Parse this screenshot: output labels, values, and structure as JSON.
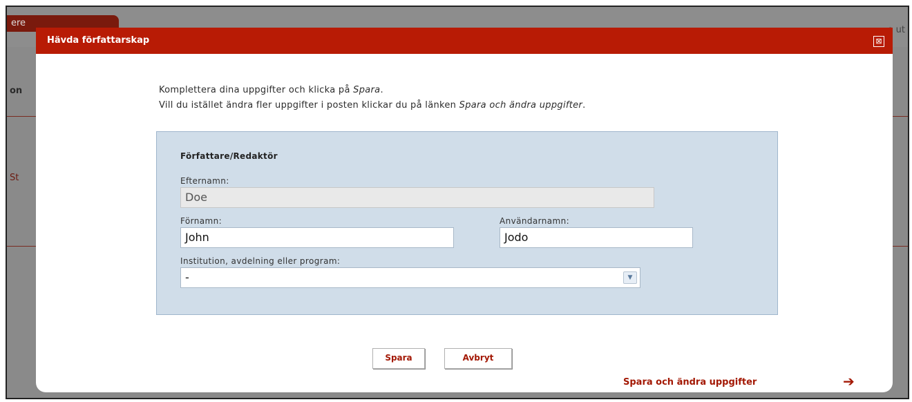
{
  "background": {
    "tab_text": "ere",
    "right_text": "e ut",
    "left_text_1": "on",
    "left_text_2": "St"
  },
  "dialog": {
    "title": "Hävda författarskap",
    "close_symbol": "⊠"
  },
  "intro": {
    "line1_prefix": "Komplettera dina uppgifter och klicka på ",
    "line1_italic": "Spara",
    "line1_suffix": ".",
    "line2_prefix": "Vill du istället ändra fler uppgifter i posten klickar du på länken ",
    "line2_italic": "Spara och ändra uppgifter",
    "line2_suffix": "."
  },
  "form": {
    "section_title": "Författare/Redaktör",
    "lastname_label": "Efternamn:",
    "lastname_value": "Doe",
    "firstname_label": "Förnamn:",
    "firstname_value": "John",
    "username_label": "Användarnamn:",
    "username_value": "Jodo",
    "institution_label": "Institution, avdelning eller program:",
    "institution_value": "-",
    "select_arrow": "▼"
  },
  "buttons": {
    "save": "Spara",
    "cancel": "Avbryt"
  },
  "link": {
    "label": "Spara och ändra uppgifter",
    "arrow": "➔"
  },
  "colors": {
    "header": "#b81b05",
    "panel": "#d0dde9",
    "accent_text": "#a31804"
  }
}
